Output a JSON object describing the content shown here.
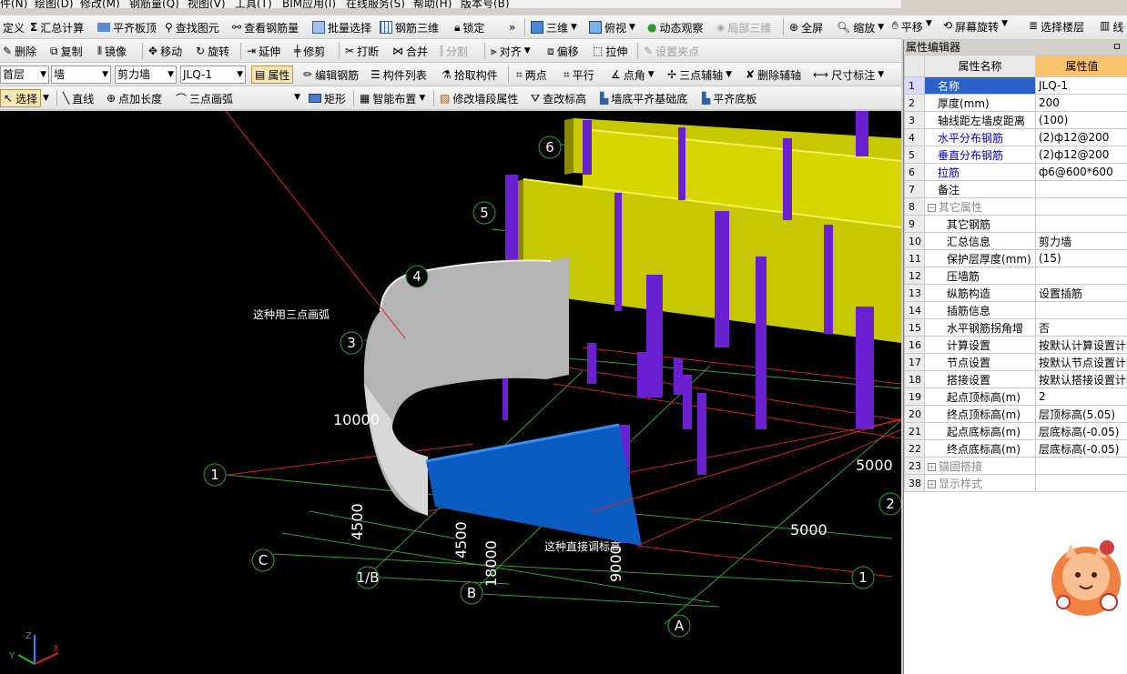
{
  "menubar": [
    "件(N)",
    "绘图(D)",
    "修改(M)",
    "钢筋量(Q)",
    "视图(V)",
    "工具(T)",
    "BIM应用(I)",
    "在线服务(S)",
    "帮助(H)",
    "版本号(B)"
  ],
  "toolbar1": {
    "define": "定义",
    "sum_calc": "汇总计算",
    "flush_slab": "平齐板顶",
    "find_element": "查找图元",
    "view_rebar": "查看钢筋量",
    "batch_select": "批量选择",
    "rebar_3d": "钢筋三维",
    "lock": "锁定",
    "view_3d": "三维",
    "top_view": "俯视",
    "dynamic_observe": "动态观察",
    "local_3d": "局部三维",
    "full_screen": "全屏",
    "zoom": "缩放",
    "pan": "平移",
    "screen_rotate": "屏幕旋转",
    "select_floor": "选择楼层",
    "line": "线"
  },
  "toolbar2": {
    "delete": "删除",
    "copy": "复制",
    "mirror": "镜像",
    "move": "移动",
    "rotate": "旋转",
    "extend": "延伸",
    "trim": "修剪",
    "break": "打断",
    "merge": "合并",
    "split": "分割",
    "align": "对齐",
    "offset": "偏移",
    "stretch": "拉伸",
    "set_pivot": "设置夹点"
  },
  "toolbar3": {
    "floor": "首层",
    "category": "墙",
    "type": "剪力墙",
    "name": "JLQ-1",
    "properties": "属性",
    "edit_rebar": "编辑钢筋",
    "component_list": "构件列表",
    "pick_component": "拾取构件",
    "two_points": "两点",
    "parallel": "平行",
    "point_angle": "点角",
    "three_point_axis": "三点辅轴",
    "delete_axis": "删除辅轴",
    "dimension": "尺寸标注"
  },
  "toolbar4": {
    "select": "选择",
    "line": "直线",
    "point_length": "点加长度",
    "three_point_arc": "三点画弧",
    "rect": "矩形",
    "smart_layout": "智能布置",
    "modify_wall_segment": "修改墙段属性",
    "check_elevation": "查改标高",
    "wall_bottom_flush": "墙底平齐基础底",
    "flush_slab_bottom": "平齐底板"
  },
  "viewport": {
    "annotation_arc": "这种用三点画弧",
    "annotation_elev": "这种直接调标高",
    "grid_labels": [
      "1",
      "2",
      "3",
      "4",
      "5",
      "6",
      "A",
      "B",
      "C",
      "1/B"
    ],
    "dims": [
      "10000",
      "4500",
      "4500",
      "18000",
      "9000",
      "5000",
      "5000"
    ],
    "axis_x": "X",
    "axis_y": "Y",
    "axis_z": "Z"
  },
  "property_panel": {
    "title": "属性编辑器",
    "pin": "ㅁ",
    "col_name": "属性名称",
    "col_value": "属性值",
    "rows": [
      {
        "num": "1",
        "name": "名称",
        "value": "JLQ-1"
      },
      {
        "num": "2",
        "name": "厚度(mm)",
        "value": "200"
      },
      {
        "num": "3",
        "name": "轴线距左墙皮距离",
        "value": "(100)"
      },
      {
        "num": "4",
        "name": "水平分布钢筋",
        "value": "(2)ф12@200"
      },
      {
        "num": "5",
        "name": "垂直分布钢筋",
        "value": "(2)ф12@200"
      },
      {
        "num": "6",
        "name": "拉筋",
        "value": "ф6@600*600"
      },
      {
        "num": "7",
        "name": "备注",
        "value": ""
      },
      {
        "num": "8",
        "name": "其它属性",
        "value": ""
      },
      {
        "num": "9",
        "name": "其它钢筋",
        "value": ""
      },
      {
        "num": "10",
        "name": "汇总信息",
        "value": "剪力墙"
      },
      {
        "num": "11",
        "name": "保护层厚度(mm)",
        "value": "(15)"
      },
      {
        "num": "12",
        "name": "压墙筋",
        "value": ""
      },
      {
        "num": "13",
        "name": "纵筋构造",
        "value": "设置插筋"
      },
      {
        "num": "14",
        "name": "插筋信息",
        "value": ""
      },
      {
        "num": "15",
        "name": "水平钢筋拐角增",
        "value": "否"
      },
      {
        "num": "16",
        "name": "计算设置",
        "value": "按默认计算设置计算"
      },
      {
        "num": "17",
        "name": "节点设置",
        "value": "按默认节点设置计算"
      },
      {
        "num": "18",
        "name": "搭接设置",
        "value": "按默认搭接设置计算"
      },
      {
        "num": "19",
        "name": "起点顶标高(m)",
        "value": "2"
      },
      {
        "num": "20",
        "name": "终点顶标高(m)",
        "value": "层顶标高(5.05)"
      },
      {
        "num": "21",
        "name": "起点底标高(m)",
        "value": "层底标高(-0.05)"
      },
      {
        "num": "22",
        "name": "终点底标高(m)",
        "value": "层底标高(-0.05)"
      },
      {
        "num": "23",
        "name": "锚固搭接",
        "value": ""
      },
      {
        "num": "38",
        "name": "显示样式",
        "value": ""
      }
    ]
  },
  "colors": {
    "wall_yellow": "#c8c800",
    "rebar_purple": "#6a1fd0",
    "arc_wall": "#b4b4b4",
    "blue_wall": "#0a5cc0",
    "grid_green": "#2fa02f",
    "grid_red": "#d02020"
  }
}
